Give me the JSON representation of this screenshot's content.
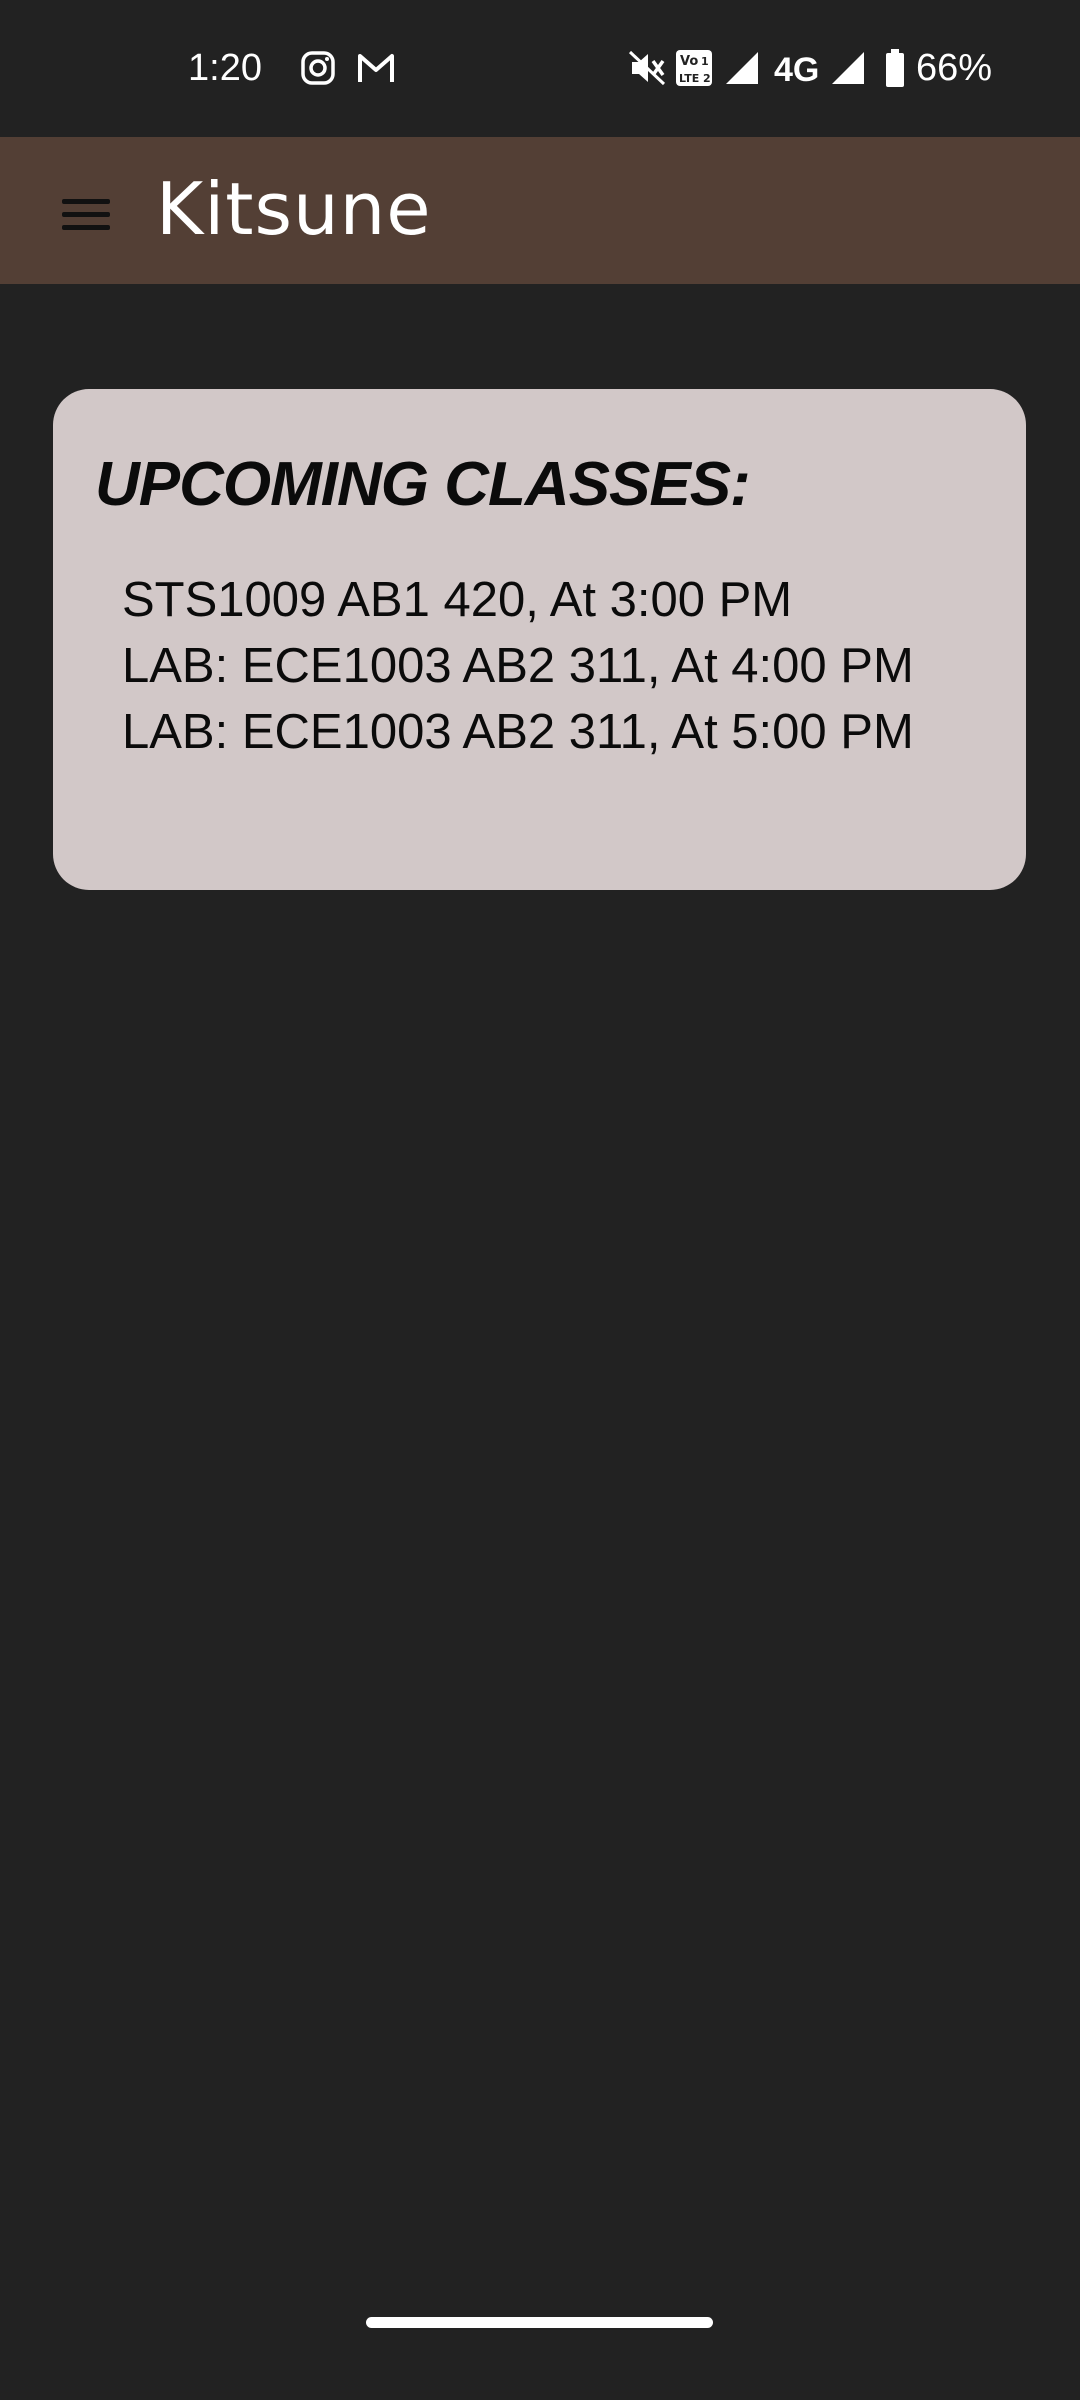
{
  "status_bar": {
    "time": "1:20",
    "network": "4G",
    "battery": "66%",
    "icons": [
      "instagram-icon",
      "gmail-icon",
      "mute-icon",
      "volte-icon",
      "signal-icon",
      "signal-icon",
      "battery-icon"
    ]
  },
  "app_bar": {
    "title": "Kitsune",
    "menu_icon": "hamburger-menu-icon"
  },
  "card": {
    "title": "UPCOMING CLASSES:",
    "classes": [
      "STS1009 AB1 420, At 3:00 PM",
      "LAB: ECE1003 AB2 311, At 4:00 PM",
      "LAB: ECE1003 AB2 311, At 5:00 PM"
    ]
  },
  "colors": {
    "background": "#222222",
    "app_bar": "#533f35",
    "card": "#d2c8c8",
    "text_dark": "#0b0b0b",
    "text_light": "#ffffff"
  }
}
